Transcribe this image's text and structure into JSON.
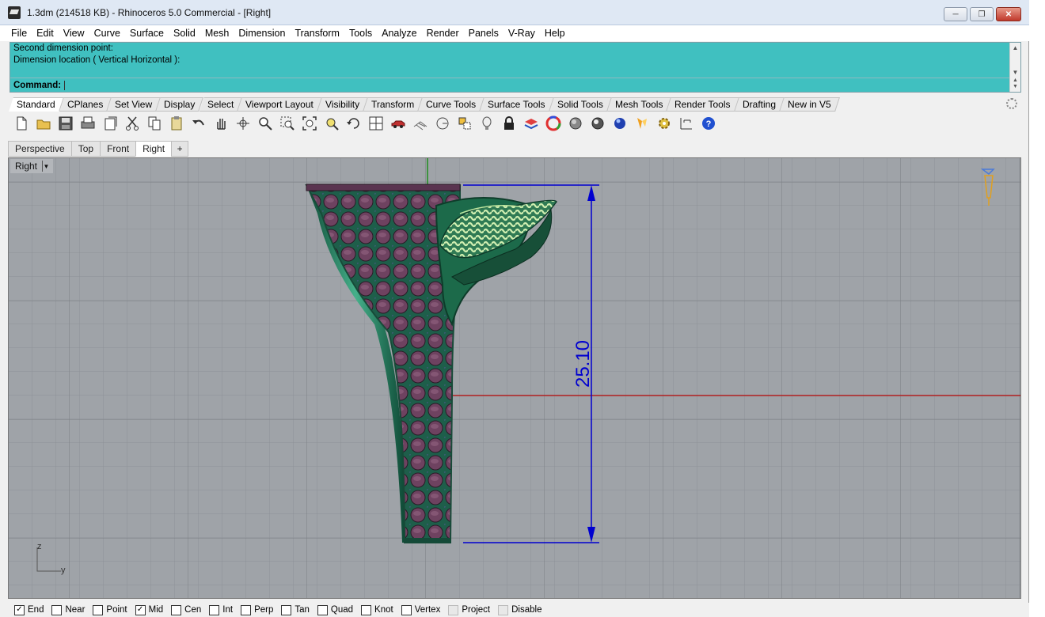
{
  "window": {
    "title": "1.3dm (214518 KB) - Rhinoceros 5.0 Commercial - [Right]",
    "controls": [
      "minimize",
      "restore",
      "close"
    ]
  },
  "menu": [
    "File",
    "Edit",
    "View",
    "Curve",
    "Surface",
    "Solid",
    "Mesh",
    "Dimension",
    "Transform",
    "Tools",
    "Analyze",
    "Render",
    "Panels",
    "V-Ray",
    "Help"
  ],
  "command": {
    "history": [
      "Second dimension point:",
      "Dimension location ( Vertical  Horizontal ):"
    ],
    "prompt_label": "Command:",
    "value": ""
  },
  "toolbar_tabs": {
    "active": "Standard",
    "items": [
      "Standard",
      "CPlanes",
      "Set View",
      "Display",
      "Select",
      "Viewport Layout",
      "Visibility",
      "Transform",
      "Curve Tools",
      "Surface Tools",
      "Solid Tools",
      "Mesh Tools",
      "Render Tools",
      "Drafting",
      "New in V5"
    ]
  },
  "tool_icons": [
    "new-file-icon",
    "open-file-icon",
    "save-icon",
    "print-icon",
    "import-icon",
    "cut-icon",
    "copy-icon",
    "paste-icon",
    "undo-icon",
    "pan-hand-icon",
    "rotate-view-icon",
    "zoom-icon",
    "zoom-window-icon",
    "zoom-extents-icon",
    "zoom-selected-icon",
    "undo-view-icon",
    "four-viewports-icon",
    "car-icon",
    "grid-options-icon",
    "cplane-icon",
    "named-views-icon",
    "light-icon",
    "lock-icon",
    "layers-icon",
    "color-wheel-icon",
    "shaded-sphere-icon",
    "rendered-sphere-icon",
    "render-sphere-blue-icon",
    "materials-icon",
    "options-gear-icon",
    "dimension-icon",
    "help-icon"
  ],
  "viewport_tabs": {
    "active": "Right",
    "items": [
      "Perspective",
      "Top",
      "Front",
      "Right"
    ],
    "add_symbol": "+"
  },
  "viewport": {
    "name": "Right",
    "dimension_value": "25.10",
    "axis_labels": {
      "vertical": "z",
      "horizontal": "y"
    },
    "colors": {
      "background": "#9fa3a8",
      "grid": "#8c9095",
      "x_axis": "#b02020",
      "z_axis": "#1e8c1e",
      "dimension": "#0000d0",
      "model_green": "#1f6e50",
      "model_pink": "#7a4a68"
    }
  },
  "osnaps": [
    {
      "label": "End",
      "checked": true,
      "enabled": true
    },
    {
      "label": "Near",
      "checked": false,
      "enabled": true
    },
    {
      "label": "Point",
      "checked": false,
      "enabled": true
    },
    {
      "label": "Mid",
      "checked": true,
      "enabled": true
    },
    {
      "label": "Cen",
      "checked": false,
      "enabled": true
    },
    {
      "label": "Int",
      "checked": false,
      "enabled": true
    },
    {
      "label": "Perp",
      "checked": false,
      "enabled": true
    },
    {
      "label": "Tan",
      "checked": false,
      "enabled": true
    },
    {
      "label": "Quad",
      "checked": false,
      "enabled": true
    },
    {
      "label": "Knot",
      "checked": false,
      "enabled": true
    },
    {
      "label": "Vertex",
      "checked": false,
      "enabled": true
    },
    {
      "label": "Project",
      "checked": false,
      "enabled": false
    },
    {
      "label": "Disable",
      "checked": false,
      "enabled": false
    }
  ]
}
